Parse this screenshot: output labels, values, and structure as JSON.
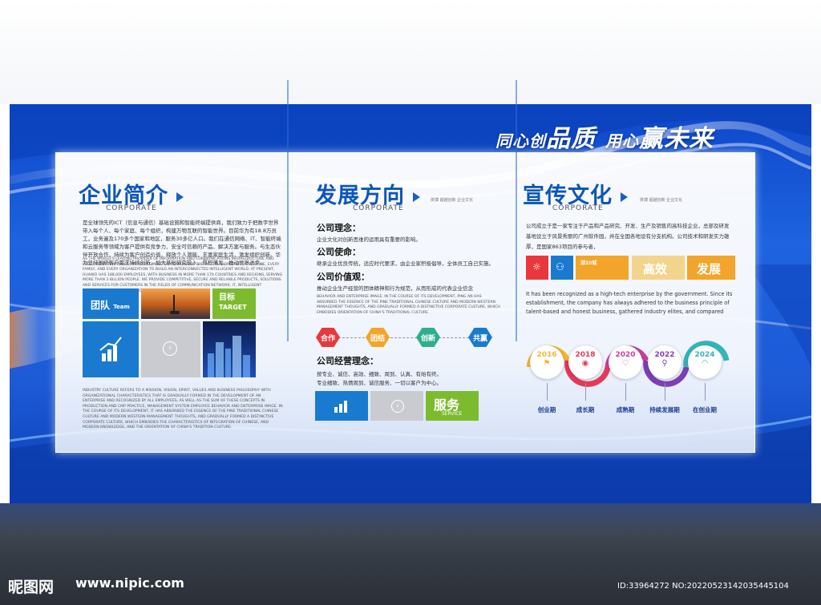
{
  "slogan": {
    "part1": "同心创",
    "part2": "品质",
    "part3": "用心",
    "part4": "赢未来"
  },
  "col1": {
    "title": "企业简介",
    "corporate": "CORPORATE",
    "body": "是全球领先的ICT（信息与通信）基础设施和智能终端提供商，我们致力于把数字世界带入每个人、每个家庭、每个组织，构建万物互联的智能世界。目前华为有18.8万员工，业务遍及170多个国家和地区，服务30多亿人口。我们在通信网络、IT、智能终端和云服务等领域为客户提供有竞争力、安全可信赖的产品、解决方案与服务。与生态伙伴开放合作，持续为客户创造价值，释放个人潜能，丰富家庭生活，激发组织创新。华为坚持围绕客户需求持续创新，加大基础研究投入，厚积薄发，推动世界进步。",
    "body_en": "As the world's leading provider of information and communications infrastructure and intelligent terminals, we are committed to bringing the digital world into everyone, every family, and every organization to build an interconnected intelligent world. At present, Huawei has 188,000 employees, with business in more than 170 countries and regions, serving more than 3 billion people. We provide competitive, secure and reliable products, solutions and services for customers in the fields of communication network, IT, intelligent terminals and cloud services.",
    "tile_team": "团队",
    "tile_team_en": "Team",
    "tile_target": "目标",
    "tile_target_en": "TARGET",
    "culture_en": "Industry culture refers to a mission, vision, spirit, values and business philosophy with organizational characteristics that is gradually formed in the development of an enterprise and recognized by all employees, as well as the sum of these concepts in production and cmp practice, management system employee behavior and enterprise image. In the course of its development, it has absorbed the essence of the pine traditional Chinese culture and modern western management thoughts, and gradually formed a distinctive corporate culture, which embodies the characteristics of integration of Chinese, and modern knowledge, and the orientation of China's tradition culture."
  },
  "col2": {
    "title": "发展方向",
    "corporate": "CORPORATE",
    "tiny": "拼搏 超越创新 企业文化",
    "concept_h": "公司理念：",
    "concept_t": "企业文化对创新思维的运用具有重要的影响。",
    "mission_h": "公司使命：",
    "mission_t": "继承企业优良传统，适应时代要求，由企业家积极倡导，全体员工自己实施。",
    "values_h": "公司价值观：",
    "values_t": "推动企业生产经营的团体精神和行为规范，从而形成的代表企业信念",
    "values_en": "Behavior and enterprise image. In the course of its development, ping an has absorbed the essence of the pine traditional Chinese culture and modern western management thoughts, and gradually formed a distinctive corporate culture, which embodies orientation of China's traditional culture.",
    "hexes": [
      "合作",
      "团结",
      "创新",
      "共赢"
    ],
    "op_h": "公司经营理念：",
    "op_t1": "按专业、诚信、高效、细致、周到、认真、有始有终。",
    "op_t2": "专业细致、热情周到、诚信服务、一切以客户为中心。",
    "service": "服务",
    "service_en": "SERVICE"
  },
  "col3": {
    "title": "宣传文化",
    "corporate": "CORPORATE",
    "tiny": "拼搏 超越创新 企业文化",
    "body": "公司成立于是一家专注于产品和产品研究、开发、生产及销售的高科技企业，总部及研发基地设立于风景秀丽的广州软件园，并在全国各地设有分支机构。公司技术和研发实力雄厚，是国家863项目的参与者，",
    "tile_small": "湖10城",
    "tile_eff": "高效",
    "tile_dev": "发展",
    "body_en": "It has been recognized as a high-tech enterprise by the government. Since its establishment, the company has always adhered to the business principle of talent-based and honest business, gathered industry elites, and compared",
    "timeline": [
      {
        "year": "2016",
        "stage": "创业期",
        "color": "#f4b731",
        "icon": "megaphone-icon",
        "glyph": "⚑"
      },
      {
        "year": "2018",
        "stage": "成长期",
        "color": "#e6395a",
        "icon": "eye-icon",
        "glyph": "◉"
      },
      {
        "year": "2020",
        "stage": "成熟期",
        "color": "#c93ea0",
        "icon": "heart-icon",
        "glyph": "♡"
      },
      {
        "year": "2022",
        "stage": "持续发展期",
        "color": "#7d3fb5",
        "icon": "search-icon",
        "glyph": "⚲"
      },
      {
        "year": "2024",
        "stage": "在创业期",
        "color": "#33b6b8",
        "icon": "wifi-icon",
        "glyph": "◠"
      }
    ]
  },
  "watermark": {
    "logo": "昵图网",
    "url": "www.nipic.com",
    "id": "ID:33964272 NO:20220523142035445104"
  },
  "colors": {
    "blue": "#1a7ad0",
    "green": "#7dbb2e",
    "orange": "#f2a52a",
    "heading": "#0d56b8"
  }
}
